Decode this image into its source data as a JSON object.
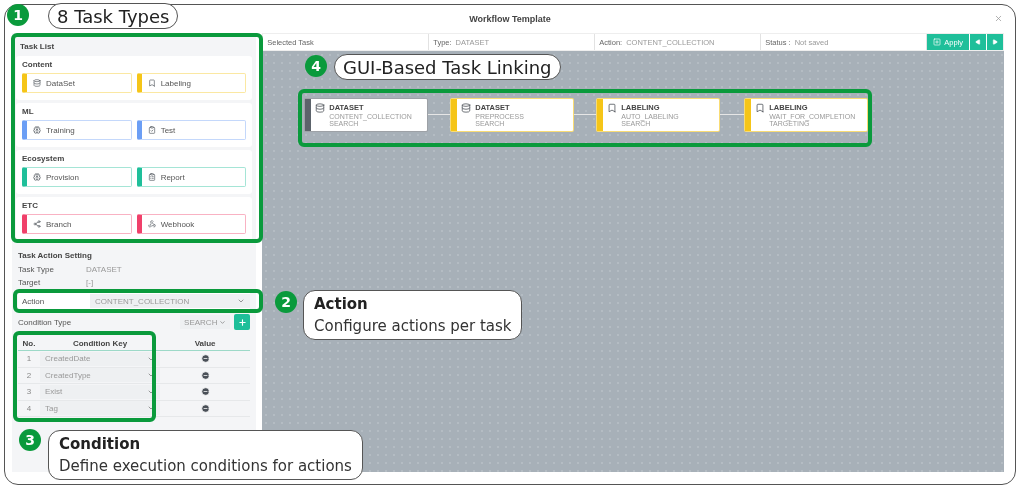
{
  "dialog": {
    "title": "Workflow Template"
  },
  "task_list": {
    "title": "Task List",
    "groups": [
      {
        "name": "Content",
        "color": "#f5c518",
        "items": [
          {
            "label": "DataSet",
            "kind": "dataset"
          },
          {
            "label": "Labeling",
            "kind": "labeling"
          }
        ]
      },
      {
        "name": "ML",
        "color": "#6b9ef5",
        "items": [
          {
            "label": "Training",
            "kind": "training"
          },
          {
            "label": "Test",
            "kind": "test"
          }
        ]
      },
      {
        "name": "Ecosystem",
        "color": "#1fbf9a",
        "items": [
          {
            "label": "Provision",
            "kind": "training"
          },
          {
            "label": "Report",
            "kind": "report"
          }
        ]
      },
      {
        "name": "ETC",
        "color": "#f0406a",
        "items": [
          {
            "label": "Branch",
            "kind": "branch"
          },
          {
            "label": "Webhook",
            "kind": "webhook"
          }
        ]
      }
    ]
  },
  "action_setting": {
    "title": "Task Action Setting",
    "fields": [
      {
        "label": "Task Type",
        "value": "DATASET"
      },
      {
        "label": "Target",
        "value": "[-]"
      }
    ],
    "action": {
      "label": "Action",
      "value": "CONTENT_COLLECTION"
    },
    "condition_type": {
      "label": "Condition Type",
      "value": "SEARCH"
    },
    "conditions": {
      "columns": [
        "No.",
        "Condition Key",
        "Value"
      ],
      "rows": [
        {
          "no": "1",
          "key": "CreatedDate"
        },
        {
          "no": "2",
          "key": "CreatedType"
        },
        {
          "no": "3",
          "key": "Exist"
        },
        {
          "no": "4",
          "key": "Tag"
        }
      ]
    }
  },
  "toolbar": {
    "cells": [
      {
        "label": "Selected Task"
      },
      {
        "label": "Type:",
        "value": "DATASET"
      },
      {
        "label": "Action:",
        "value": "CONTENT_COLLECTION"
      },
      {
        "label": "Status :",
        "value": "Not saved"
      }
    ],
    "apply": "Apply"
  },
  "nodes": [
    {
      "type": "DATASET",
      "kind": "dataset",
      "action": "CONTENT_COLLECTION",
      "condition": "SEARCH",
      "color": "#5c636b"
    },
    {
      "type": "DATASET",
      "kind": "dataset",
      "action": "PREPROCESS",
      "condition": "SEARCH",
      "color": "#f5c518"
    },
    {
      "type": "LABELING",
      "kind": "labeling",
      "action": "AUTO_LABELING",
      "condition": "SEARCH",
      "color": "#f5c518"
    },
    {
      "type": "LABELING",
      "kind": "labeling",
      "action": "WAIT_FOR_COMPLETION",
      "condition": "TARGETING",
      "color": "#f5c518"
    }
  ],
  "annotations": [
    {
      "number": "1",
      "title": "8 Task Types"
    },
    {
      "number": "2",
      "title": "Action",
      "text": "Configure actions per task"
    },
    {
      "number": "3",
      "title": "Condition",
      "text": "Define execution conditions for actions"
    },
    {
      "number": "4",
      "title": "GUI-Based Task Linking"
    }
  ]
}
